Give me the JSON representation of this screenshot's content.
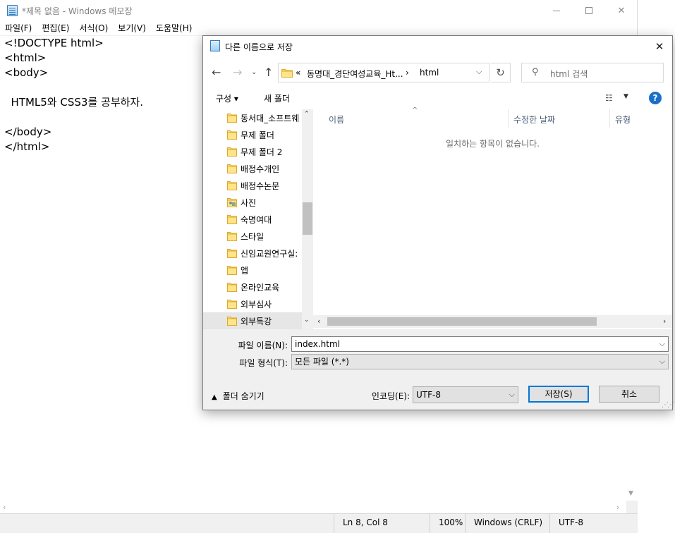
{
  "notepad": {
    "title": "*제목 없음 - Windows 메모장",
    "menu": [
      {
        "label": "파일(F)"
      },
      {
        "label": "편집(E)"
      },
      {
        "label": "서식(O)"
      },
      {
        "label": "보기(V)"
      },
      {
        "label": "도움말(H)"
      }
    ],
    "lines": [
      "<!DOCTYPE html>",
      "<html>",
      "<body>",
      "",
      "  HTML5와 CSS3를 공부하자.",
      "",
      "</body>",
      "</html>"
    ],
    "status": {
      "position": "Ln 8, Col 8",
      "zoom": "100%",
      "line_ending": "Windows (CRLF)",
      "encoding": "UTF-8"
    }
  },
  "dialog": {
    "title": "다른 이름으로 저장",
    "address": {
      "chevron": "«",
      "parent": "동명대_경단여성교육_Ht...",
      "separator": "›",
      "current": "html"
    },
    "search_placeholder": "html 검색",
    "toolbar": {
      "organize": "구성 ▾",
      "new_folder": "새 폴더",
      "help": "?"
    },
    "tree_items": [
      {
        "label": "동서대_소프트웨"
      },
      {
        "label": "무제 폴더"
      },
      {
        "label": "무제 폴더 2"
      },
      {
        "label": "배정수개인"
      },
      {
        "label": "배정수논문"
      },
      {
        "label": "사진"
      },
      {
        "label": "숙명여대"
      },
      {
        "label": "스타일"
      },
      {
        "label": "신임교원연구실:"
      },
      {
        "label": "앱"
      },
      {
        "label": "온라인교육"
      },
      {
        "label": "외부심사"
      },
      {
        "label": "외부특강"
      }
    ],
    "columns": {
      "name": "이름",
      "date": "수정한 날짜",
      "type": "유형"
    },
    "empty_message": "일치하는 항목이 없습니다.",
    "filename_label": "파일 이름(N):",
    "filename_value": "index.html",
    "filetype_label": "파일 형식(T):",
    "filetype_value": "모든 파일 (*.*)",
    "hide_folders": "폴더 숨기기",
    "encoding_label": "인코딩(E):",
    "encoding_value": "UTF-8",
    "save_button": "저장(S)",
    "cancel_button": "취소"
  }
}
